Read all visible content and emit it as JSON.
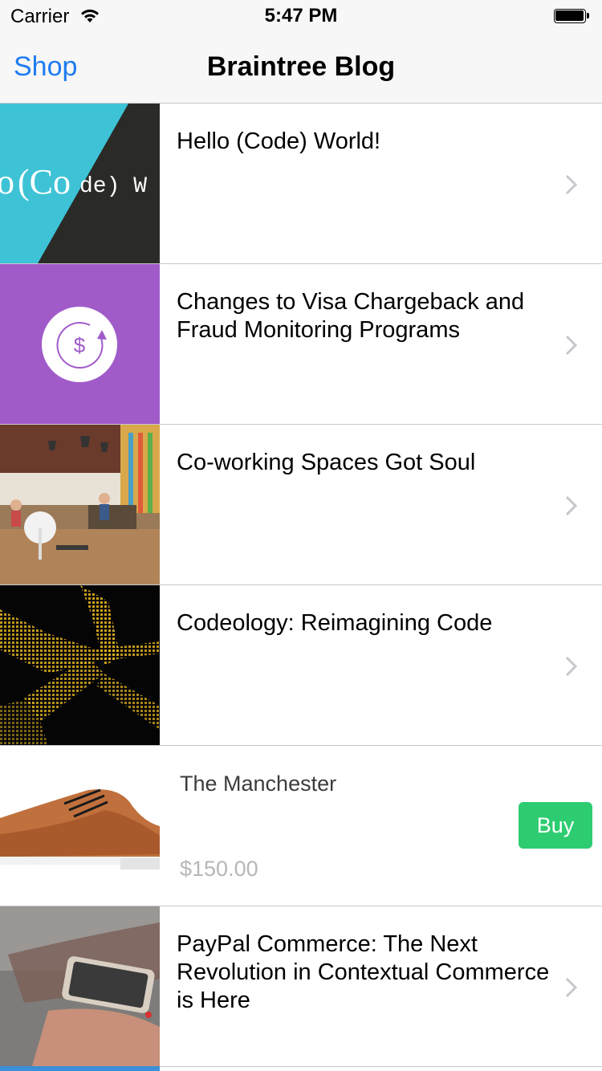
{
  "status_bar": {
    "carrier": "Carrier",
    "time": "5:47 PM",
    "wifi_icon": "wifi-icon",
    "battery_icon": "battery-icon"
  },
  "nav": {
    "back_label": "Shop",
    "title": "Braintree Blog"
  },
  "rows": [
    {
      "kind": "article",
      "title": "Hello (Code) World!",
      "thumb_text": "(Code) W",
      "thumb_text_lead": "o"
    },
    {
      "kind": "article",
      "title": "Changes to Visa Chargeback and Fraud Monitoring Programs",
      "thumb_icon": "dollar-refresh-icon",
      "thumb_symbol": "$"
    },
    {
      "kind": "article",
      "title": "Co-working Spaces Got Soul"
    },
    {
      "kind": "article",
      "title": "Codeology: Reimagining Code"
    },
    {
      "kind": "product",
      "name": "The Manchester",
      "price": "$150.00",
      "buy_label": "Buy"
    },
    {
      "kind": "article",
      "title": "PayPal Commerce: The Next Revolution in Contextual Commerce is Here"
    }
  ],
  "colors": {
    "accent": "#1e7cf0",
    "buy_button": "#2ecc71",
    "separator": "#c8c7cc"
  }
}
